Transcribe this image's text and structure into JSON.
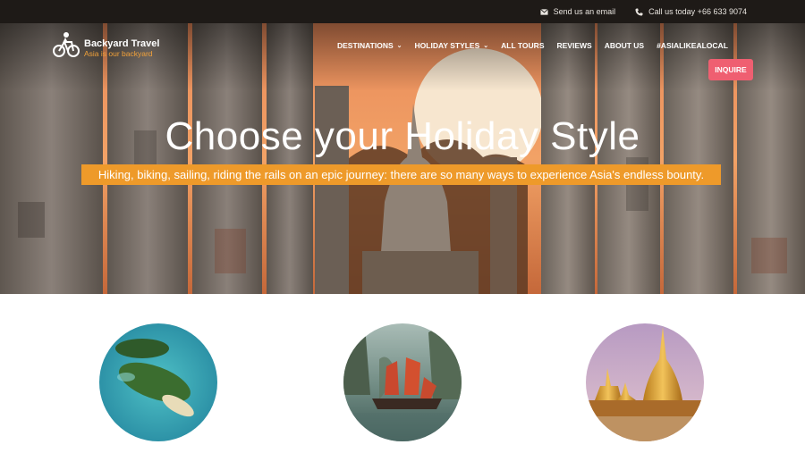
{
  "topbar": {
    "email_label": "Send us an email",
    "phone_label": "Call us today +66 633 9074"
  },
  "logo": {
    "name": "Backyard Travel",
    "tagline": "Asia is our backyard"
  },
  "menu": [
    {
      "label": "DESTINATIONS",
      "has_dropdown": true
    },
    {
      "label": "HOLIDAY STYLES",
      "has_dropdown": true
    },
    {
      "label": "ALL TOURS",
      "has_dropdown": false
    },
    {
      "label": "REVIEWS",
      "has_dropdown": false
    },
    {
      "label": "ABOUT US",
      "has_dropdown": false
    },
    {
      "label": "#ASIALIKEALOCAL",
      "has_dropdown": false
    }
  ],
  "inquire_label": "INQUIRE",
  "hero": {
    "title": "Choose your Holiday Style",
    "subtitle": "Hiking, biking, sailing, riding the rails on an epic journey: there are so many ways to experience Asia's endless bounty."
  },
  "styles": [
    {
      "image": "tropical-island"
    },
    {
      "image": "junk-boat"
    },
    {
      "image": "golden-pagoda"
    }
  ],
  "colors": {
    "accent_orange": "#ee9a2a",
    "inquire_pink": "#ef5f71",
    "topbar": "#1e1a17"
  }
}
